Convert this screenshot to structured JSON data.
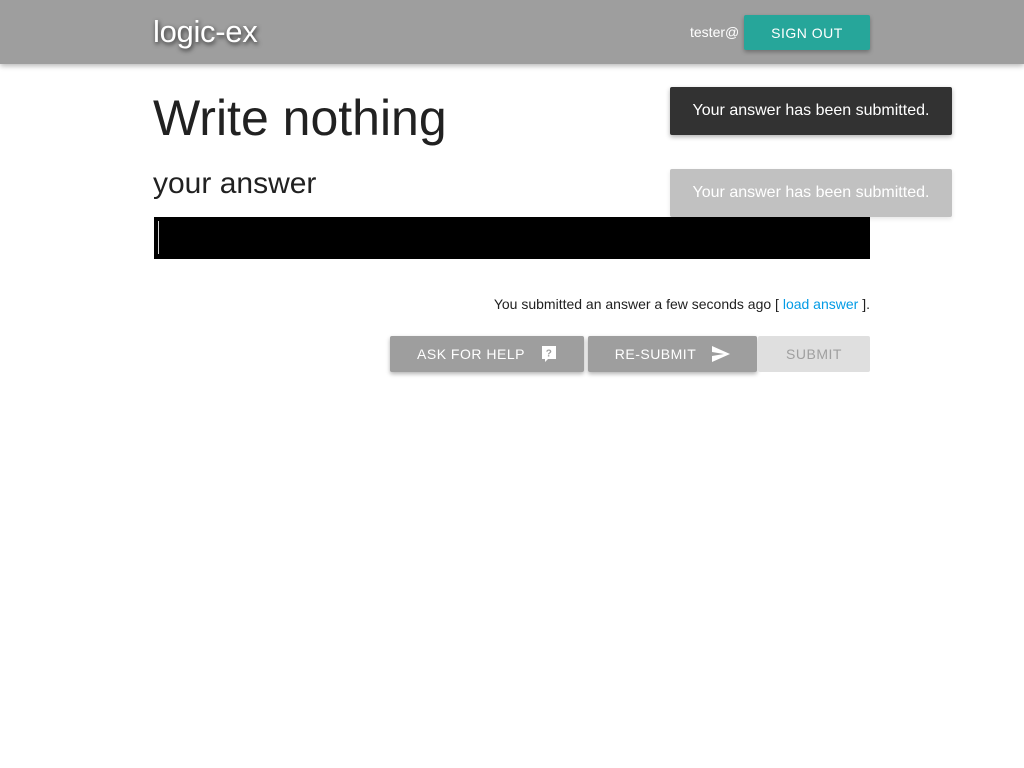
{
  "navbar": {
    "brand": "logic-ex",
    "user": "tester@",
    "signout_label": "Sign out"
  },
  "page": {
    "title": "Write nothing",
    "subtitle": "your answer",
    "answer_value": ""
  },
  "status": {
    "text_before": "You submitted an answer a few seconds ago [",
    "link_label": "load answer",
    "text_after": "]."
  },
  "buttons": {
    "help_label": "Ask for help",
    "help_icon": "help-question-icon",
    "resubmit_label": "Re-submit",
    "resubmit_icon": "send-icon",
    "submit_label": "Submit"
  },
  "toasts": [
    {
      "message": "Your answer has been submitted."
    },
    {
      "message": "Your answer has been submitted."
    }
  ],
  "colors": {
    "navbar": "#9e9e9e",
    "accent": "#26a69a",
    "link": "#039be5",
    "toast": "#323232"
  }
}
